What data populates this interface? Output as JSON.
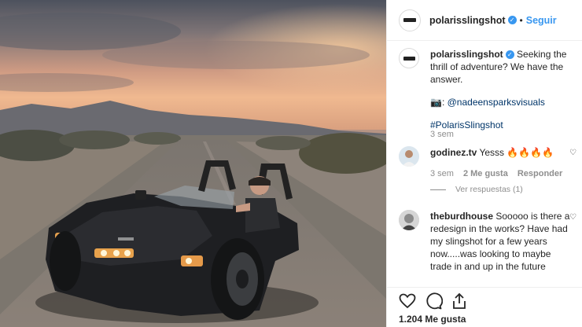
{
  "post": {
    "author": "polarisslingshot",
    "follow_label": "Seguir",
    "separator": "•",
    "likes": "1.204 Me gusta"
  },
  "caption": {
    "username": "polarisslingshot",
    "text": "Seeking the thrill of adventure? We have the answer.",
    "camera_emoji": "📷:",
    "photo_credit": "@nadeensparksvisuals",
    "hashtag": "#PolarisSlingshot",
    "time": "3 sem"
  },
  "comments": [
    {
      "username": "godinez.tv",
      "text": "Yesss 🔥🔥🔥🔥",
      "time": "3 sem",
      "likes": "2 Me gusta",
      "reply_label": "Responder",
      "view_replies": "Ver respuestas (1)"
    },
    {
      "username": "theburdhouse",
      "text": "Sooooo is there a redesign in the works? Have had my slingshot for a few years now.....was looking to maybe trade in and up in the future"
    }
  ],
  "colors": {
    "accent": "#3897f0",
    "muted": "#8e8e8e",
    "text": "#262626"
  },
  "icons": {
    "like": "heart-icon",
    "comment": "comment-icon",
    "share": "share-icon",
    "verified": "verified-badge-icon"
  }
}
